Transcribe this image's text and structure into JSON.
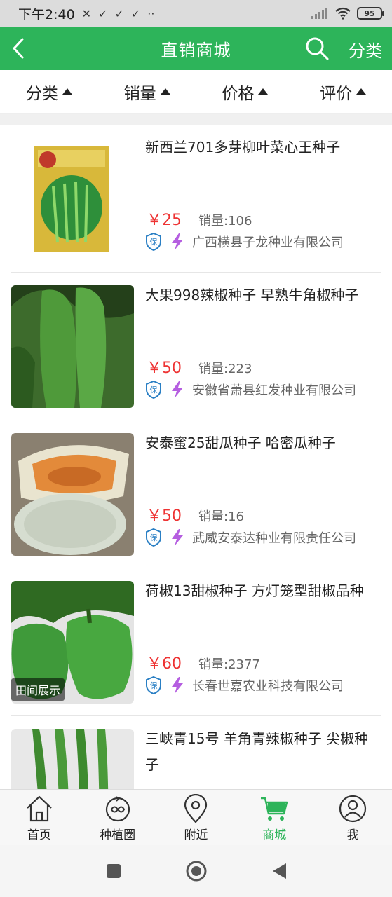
{
  "status_bar": {
    "time": "下午2:40",
    "battery": "95"
  },
  "header": {
    "title": "直销商城",
    "category_label": "分类"
  },
  "filters": [
    {
      "label": "分类"
    },
    {
      "label": "销量"
    },
    {
      "label": "价格"
    },
    {
      "label": "评价"
    }
  ],
  "products": [
    {
      "name": "新西兰701多芽柳叶菜心王种子",
      "price": "￥25",
      "sales": "销量:106",
      "company": "广西横县子龙种业有限公司",
      "tag": ""
    },
    {
      "name": "大果998辣椒种子 早熟牛角椒种子",
      "price": "￥50",
      "sales": "销量:223",
      "company": "安徽省萧县红发种业有限公司",
      "tag": ""
    },
    {
      "name": "安泰蜜25甜瓜种子 哈密瓜种子",
      "price": "￥50",
      "sales": "销量:16",
      "company": "武威安泰达种业有限责任公司",
      "tag": ""
    },
    {
      "name": "荷椒13甜椒种子 方灯笼型甜椒品种",
      "price": "￥60",
      "sales": "销量:2377",
      "company": "长春世嘉农业科技有限公司",
      "tag": "田间展示"
    },
    {
      "name": "三峡青15号 羊角青辣椒种子 尖椒种子",
      "price": "",
      "sales": "",
      "company": "",
      "tag": ""
    }
  ],
  "bottom_nav": [
    {
      "label": "首页",
      "icon": "home-icon"
    },
    {
      "label": "种植圈",
      "icon": "circle-icon"
    },
    {
      "label": "附近",
      "icon": "location-icon"
    },
    {
      "label": "商城",
      "icon": "cart-icon",
      "active": true
    },
    {
      "label": "我",
      "icon": "user-icon"
    }
  ],
  "colors": {
    "primary": "#2db45a",
    "price": "#e33333"
  }
}
